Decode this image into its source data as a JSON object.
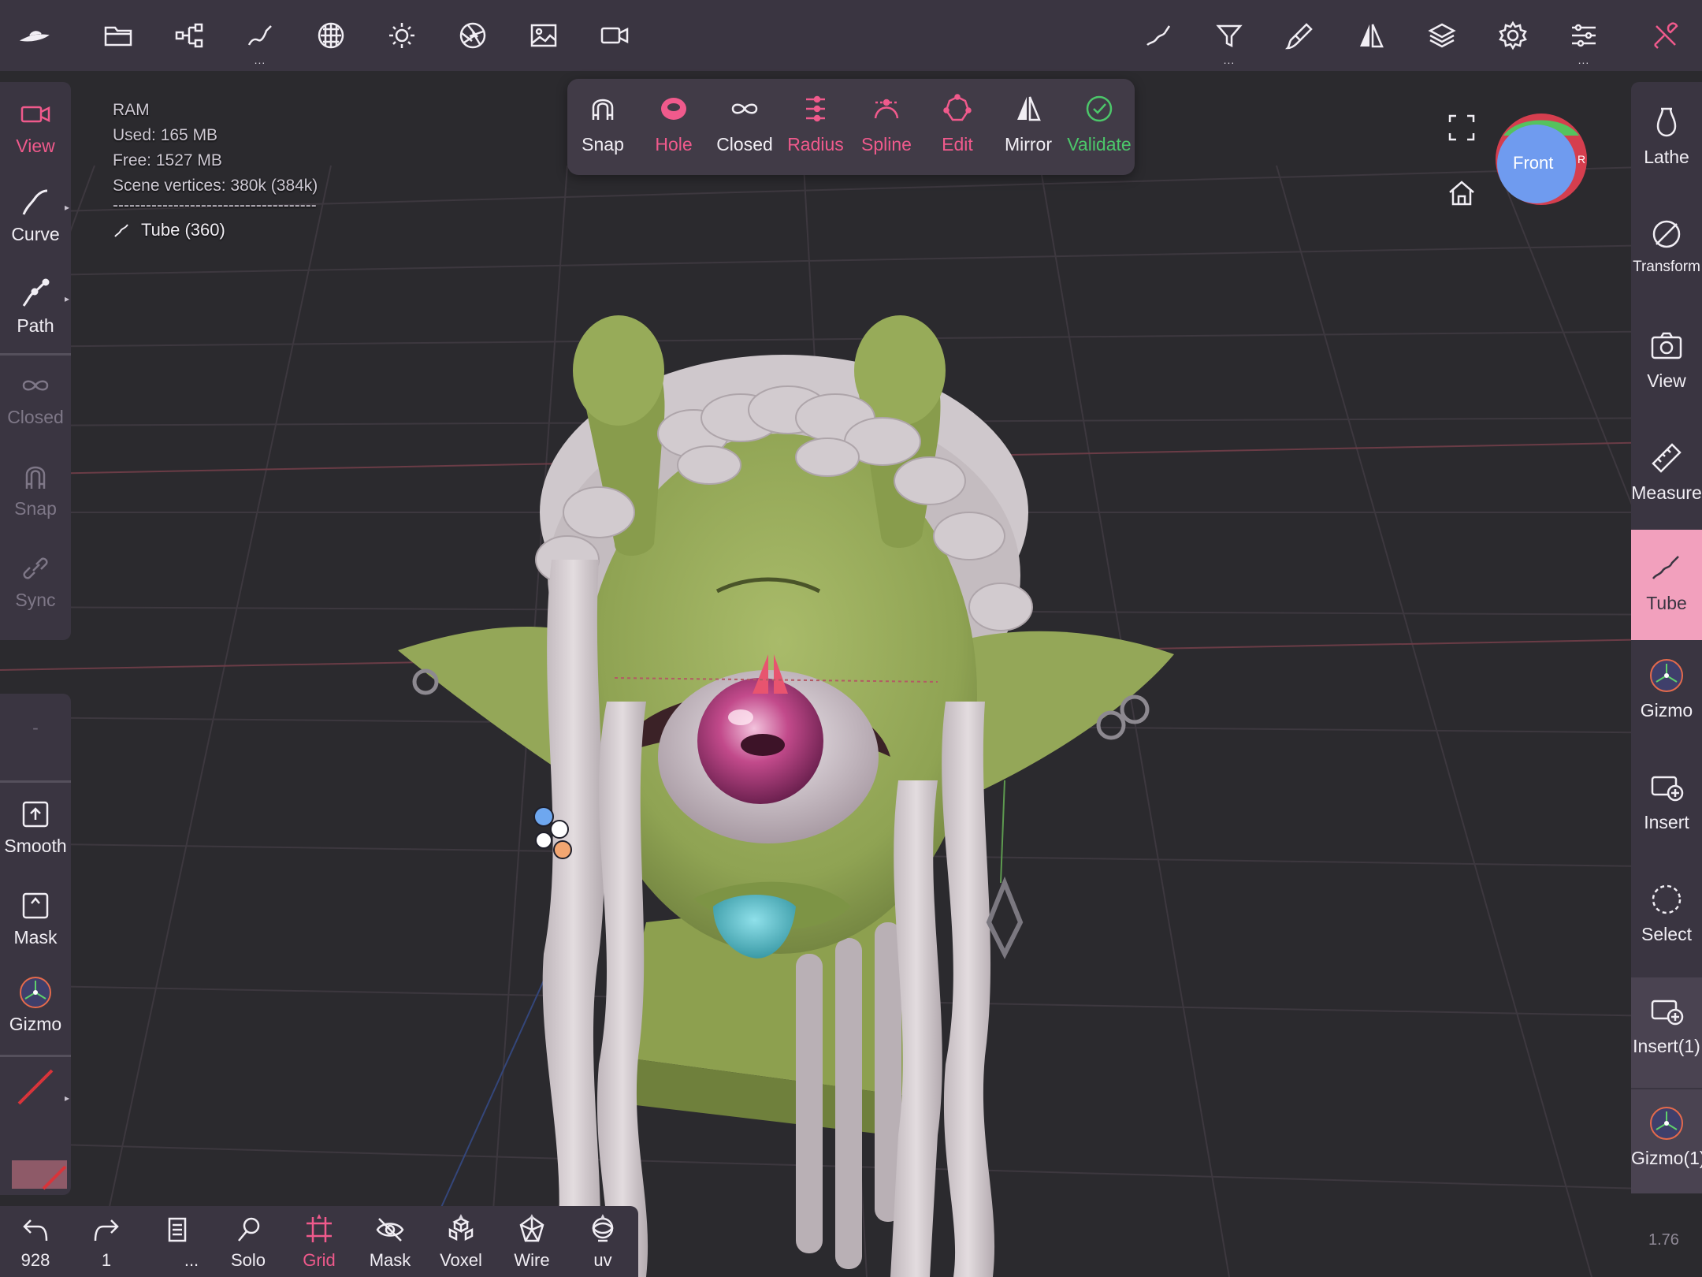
{
  "topbar": {
    "left_icons": [
      "logo-icon",
      "folder-icon",
      "scene-graph-icon",
      "curve-stroke-icon",
      "material-sphere-icon",
      "light-sun-icon",
      "aperture-icon",
      "image-icon",
      "video-camera-icon"
    ],
    "right_icons": [
      "stroke-icon",
      "filter-icon",
      "paint-brush-icon",
      "mirror-icon",
      "layers-icon",
      "settings-gear-icon",
      "sliders-icon",
      "tools-icon"
    ],
    "more_marker": "..."
  },
  "left_panel": {
    "items": [
      {
        "label": "View",
        "icon": "video-camera-icon",
        "state": "pink"
      },
      {
        "label": "Curve",
        "icon": "curve-icon",
        "state": "normal"
      },
      {
        "label": "Path",
        "icon": "path-icon",
        "state": "normal"
      },
      {
        "label": "Closed",
        "icon": "infinity-icon",
        "state": "dim"
      },
      {
        "label": "Snap",
        "icon": "magnet-icon",
        "state": "dim"
      },
      {
        "label": "Sync",
        "icon": "link-icon",
        "state": "dim"
      }
    ],
    "lower_items": [
      {
        "label": "-",
        "icon": "",
        "state": "dim"
      },
      {
        "label": "Smooth",
        "icon": "smooth-icon",
        "state": "normal"
      },
      {
        "label": "Mask",
        "icon": "mask-icon",
        "state": "normal"
      },
      {
        "label": "Gizmo",
        "icon": "gizmo-icon",
        "state": "normal"
      }
    ]
  },
  "palette": {
    "items": [
      {
        "label": "Snap",
        "color": "white",
        "icon": "magnet-icon"
      },
      {
        "label": "Hole",
        "color": "pink",
        "icon": "hole-icon"
      },
      {
        "label": "Closed",
        "color": "white",
        "icon": "infinity-icon"
      },
      {
        "label": "Radius",
        "color": "pink",
        "icon": "radius-icon"
      },
      {
        "label": "Spline",
        "color": "pink",
        "icon": "spline-icon"
      },
      {
        "label": "Edit",
        "color": "pink",
        "icon": "edit-gear-icon"
      },
      {
        "label": "Mirror",
        "color": "white",
        "icon": "mirror-icon"
      },
      {
        "label": "Validate",
        "color": "green",
        "icon": "check-circle-icon"
      }
    ]
  },
  "info": {
    "ram": "RAM",
    "used": "Used: 165 MB",
    "free": "Free: 1527 MB",
    "vertices": "Scene vertices: 380k (384k)",
    "separator": "-------------------------------------",
    "active_object": "Tube (360)"
  },
  "viewcube": {
    "label": "Front",
    "side_letter": "R"
  },
  "right_panel": {
    "items": [
      {
        "label": "Lathe",
        "icon": "lathe-icon"
      },
      {
        "label": "Transform",
        "icon": "transform-icon"
      },
      {
        "label": "View",
        "icon": "camera-icon"
      },
      {
        "label": "Measure",
        "icon": "ruler-icon"
      },
      {
        "label": "Tube",
        "icon": "tube-icon",
        "active": true
      },
      {
        "label": "Gizmo",
        "icon": "gizmo-icon"
      },
      {
        "label": "Insert",
        "icon": "insert-icon"
      },
      {
        "label": "Select",
        "icon": "select-icon"
      },
      {
        "label": "Insert(1)",
        "icon": "insert-icon"
      },
      {
        "label": "Gizmo(1)",
        "icon": "gizmo-icon"
      }
    ]
  },
  "bottombar": {
    "items": [
      {
        "label": "928",
        "icon": "undo-icon"
      },
      {
        "label": "1",
        "icon": "redo-icon"
      },
      {
        "label": "...",
        "icon": "notes-icon"
      },
      {
        "label": "Solo",
        "icon": "search-icon"
      },
      {
        "label": "Grid",
        "icon": "grid-icon",
        "active": true
      },
      {
        "label": "Mask",
        "icon": "eye-off-icon"
      },
      {
        "label": "Voxel",
        "icon": "voxel-icon"
      },
      {
        "label": "Wire",
        "icon": "wire-icon"
      },
      {
        "label": "uv",
        "icon": "uv-icon"
      }
    ]
  },
  "zoom_value": "1.76",
  "colors": {
    "accent_pink": "#f05a8c",
    "accent_green": "#4cc76a",
    "panel": "#3a3541",
    "viewport": "#2b2a2e"
  }
}
